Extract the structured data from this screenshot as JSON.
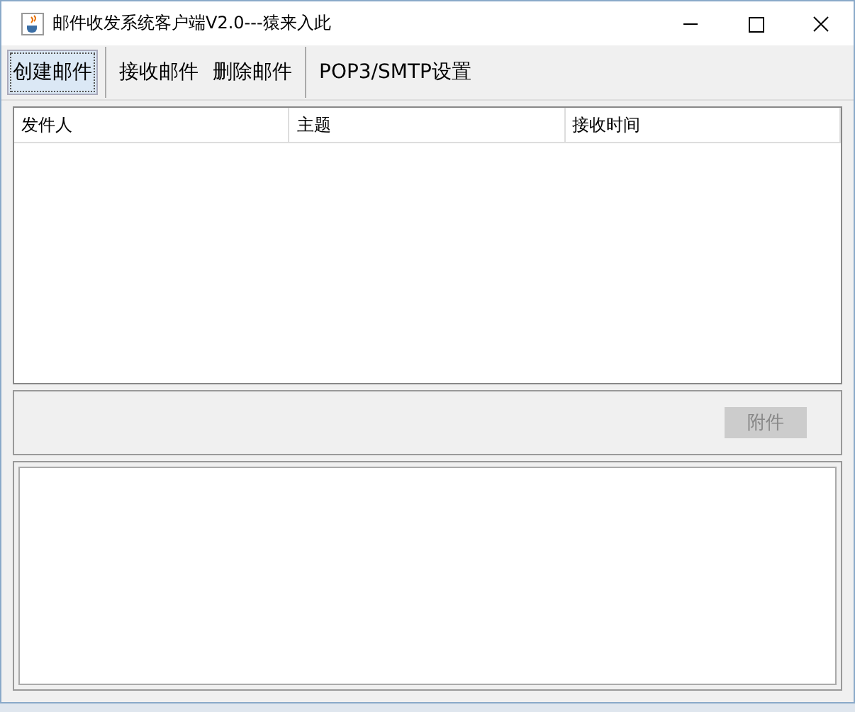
{
  "window": {
    "title": "邮件收发系统客户端V2.0---猿来入此"
  },
  "toolbar": [
    {
      "kind": "button",
      "label": "创建邮件",
      "selected": true
    },
    {
      "kind": "separator"
    },
    {
      "kind": "button",
      "label": "接收邮件",
      "selected": false
    },
    {
      "kind": "button",
      "label": "删除邮件",
      "selected": false
    },
    {
      "kind": "separator"
    },
    {
      "kind": "button",
      "label": "POP3/SMTP设置",
      "selected": false
    }
  ],
  "table": {
    "columns": [
      "发件人",
      "主题",
      "接收时间"
    ]
  },
  "attachment_button": {
    "label": "附件",
    "disabled": true
  }
}
